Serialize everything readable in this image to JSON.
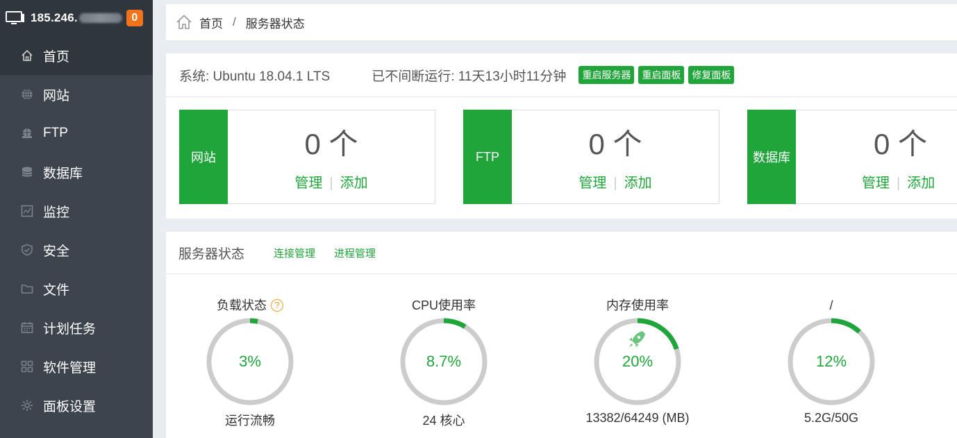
{
  "sidebar": {
    "ip_prefix": "185.246.",
    "notification_count": "0",
    "items": [
      {
        "label": "首页",
        "icon": "home-icon"
      },
      {
        "label": "网站",
        "icon": "globe-icon"
      },
      {
        "label": "FTP",
        "icon": "ftp-icon"
      },
      {
        "label": "数据库",
        "icon": "database-icon"
      },
      {
        "label": "监控",
        "icon": "monitor-icon"
      },
      {
        "label": "安全",
        "icon": "shield-icon"
      },
      {
        "label": "文件",
        "icon": "folder-icon"
      },
      {
        "label": "计划任务",
        "icon": "calendar-icon"
      },
      {
        "label": "软件管理",
        "icon": "apps-icon"
      },
      {
        "label": "面板设置",
        "icon": "gear-icon"
      }
    ],
    "active_index": 0
  },
  "breadcrumb": {
    "home": "首页",
    "separator": "/",
    "current": "服务器状态"
  },
  "system": {
    "os": "系统: Ubuntu 18.04.1 LTS",
    "uptime": "已不间断运行: 11天13小时11分钟",
    "buttons": [
      "重启服务器",
      "重启面板",
      "修复面板"
    ]
  },
  "cards": [
    {
      "tag": "网站",
      "count": "0 个",
      "manage": "管理",
      "divider": "|",
      "add": "添加"
    },
    {
      "tag": "FTP",
      "count": "0 个",
      "manage": "管理",
      "divider": "|",
      "add": "添加"
    },
    {
      "tag": "数据库",
      "count": "0 个",
      "manage": "管理",
      "divider": "|",
      "add": "添加"
    }
  ],
  "status": {
    "title": "服务器状态",
    "links": [
      "连接管理",
      "进程管理"
    ],
    "gauges": [
      {
        "label": "负载状态",
        "help": "?",
        "percent_text": "3%",
        "fraction": 0.03,
        "sub": "运行流畅"
      },
      {
        "label": "CPU使用率",
        "percent_text": "8.7%",
        "fraction": 0.087,
        "sub": "24 核心"
      },
      {
        "label": "内存使用率",
        "percent_text": "20%",
        "fraction": 0.2,
        "sub": "13382/64249 (MB)",
        "icon": "rocket-icon"
      },
      {
        "label": "/",
        "percent_text": "12%",
        "fraction": 0.12,
        "sub": "5.2G/50G"
      }
    ]
  },
  "colors": {
    "accent": "#20a53a",
    "sidebar": "#3c444d",
    "sidebar_active": "#2f363e",
    "badge": "#f0741e",
    "ring_track": "#cccccc"
  }
}
